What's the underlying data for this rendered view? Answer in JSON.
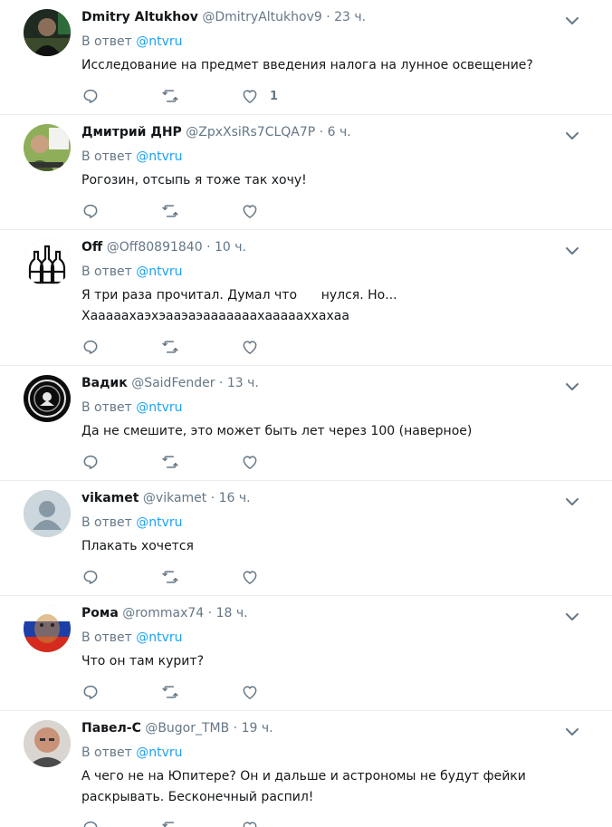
{
  "tweets": [
    {
      "name": "Dmitry Altukhov",
      "handle": "@DmitryAltukhov9",
      "time": "23 ч.",
      "reply_label": "В ответ",
      "reply_mention": "@ntvru",
      "text_lines": [
        "Исследование на предмет введения налога на лунное освещение?"
      ],
      "like_count": "1",
      "avatar": "dark-portrait"
    },
    {
      "name": "Дмитрий ДНР",
      "handle": "@ZpxXsiRs7CLQA7P",
      "time": "6 ч.",
      "reply_label": "В ответ",
      "reply_mention": "@ntvru",
      "text_lines": [
        "Рогозин, отсыпь я тоже так хочу!"
      ],
      "like_count": "",
      "avatar": "green-photo"
    },
    {
      "name": "Off",
      "handle": "@Off80891840",
      "time": "10 ч.",
      "reply_label": "В ответ",
      "reply_mention": "@ntvru",
      "text_lines": [
        "Я три раза прочитал. Думал что      нулся. Но...",
        "Хааааахаэхэааэаэааааааахаааааххахаа"
      ],
      "like_count": "",
      "avatar": "bottles"
    },
    {
      "name": "Вадик",
      "handle": "@SaidFender",
      "time": "13 ч.",
      "reply_label": "В ответ",
      "reply_mention": "@ntvru",
      "text_lines": [
        "Да не смешите, это может быть лет через 100 (наверное)"
      ],
      "like_count": "",
      "avatar": "emblem"
    },
    {
      "name": "vikamet",
      "handle": "@vikamet",
      "time": "16 ч.",
      "reply_label": "В ответ",
      "reply_mention": "@ntvru",
      "text_lines": [
        "Плакать хочется"
      ],
      "like_count": "",
      "avatar": "default"
    },
    {
      "name": "Рома",
      "handle": "@rommax74",
      "time": "18 ч.",
      "reply_label": "В ответ",
      "reply_mention": "@ntvru",
      "text_lines": [
        "Что он там курит?"
      ],
      "like_count": "",
      "avatar": "tiger-flag"
    },
    {
      "name": "Павел-С",
      "handle": "@Bugor_TMB",
      "time": "19 ч.",
      "reply_label": "В ответ",
      "reply_mention": "@ntvru",
      "text_lines": [
        "А чего не на Юпитере? Он и дальше и астрономы не будут фейки",
        "раскрывать. Бесконечный распил!"
      ],
      "like_count": "",
      "avatar": "bald-man"
    }
  ],
  "icons": {
    "reply": "reply-icon",
    "retweet": "retweet-icon",
    "like": "like-icon",
    "more": "chevron-down-icon"
  },
  "colors": {
    "name": "#14171a",
    "secondary": "#657786",
    "link": "#1da1f2",
    "divider": "#e6ecf0"
  }
}
